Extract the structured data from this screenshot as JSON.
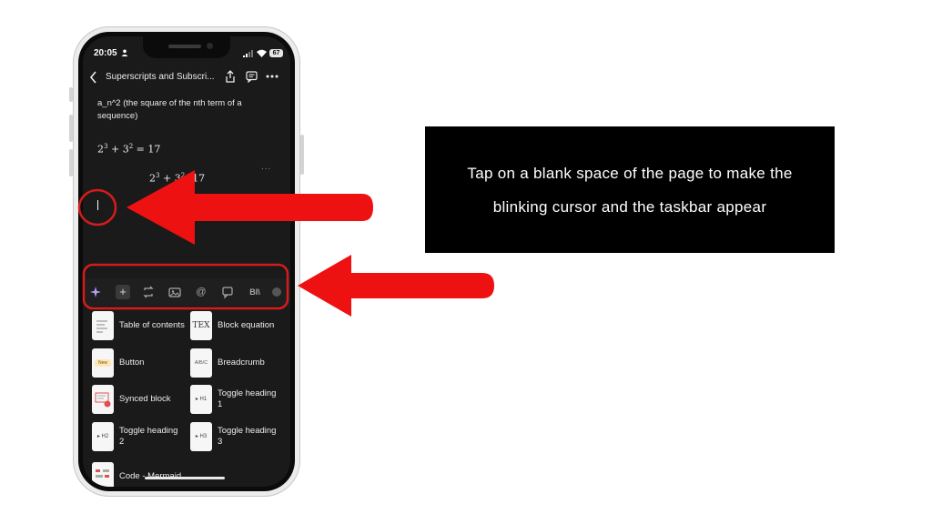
{
  "status": {
    "time": "20:05",
    "battery": "67"
  },
  "nav": {
    "title": "Superscripts and Subscri..."
  },
  "doc": {
    "paragraph": "a_n^2 (the square of the nth term of a sequence)",
    "equation1": {
      "base1": "2",
      "exp1": "3",
      "op1": " + ",
      "base2": "3",
      "exp2": "2",
      "rest": " = 17"
    },
    "equation2": {
      "base1": "2",
      "exp1": "3",
      "op1": " + ",
      "base2": "3",
      "exp2": "2",
      "rest": "17"
    },
    "dots": "..."
  },
  "toolbar": {
    "plus": "+",
    "mention": "@",
    "format": "BI\\"
  },
  "blocks": [
    {
      "label": "Table of contents",
      "icon": "table-of-contents-icon"
    },
    {
      "label": "Block equation",
      "icon": "tex-icon"
    },
    {
      "label": "Button",
      "icon": "button-preview-icon"
    },
    {
      "label": "Breadcrumb",
      "icon": "breadcrumb-icon"
    },
    {
      "label": "Synced block",
      "icon": "synced-block-icon"
    },
    {
      "label": "Toggle heading 1",
      "icon": "toggle-heading-icon"
    },
    {
      "label": "Toggle heading 2",
      "icon": "toggle-heading-icon"
    },
    {
      "label": "Toggle heading 3",
      "icon": "toggle-heading-icon"
    },
    {
      "label": "Code - Mermaid",
      "icon": "mermaid-code-icon"
    }
  ],
  "thumb_text": {
    "button": "New",
    "breadcrumb": "A/B/C",
    "h1": "H1",
    "h2": "H2",
    "h3": "H3",
    "tex": "TEX"
  },
  "callout": {
    "text": "Tap on a blank space of the page to make the blinking cursor and the taskbar appear"
  },
  "colors": {
    "arrow": "#ee1111",
    "highlight": "#e21b1b",
    "screen_bg": "#1a1a1a",
    "caption_bg": "#000000"
  }
}
